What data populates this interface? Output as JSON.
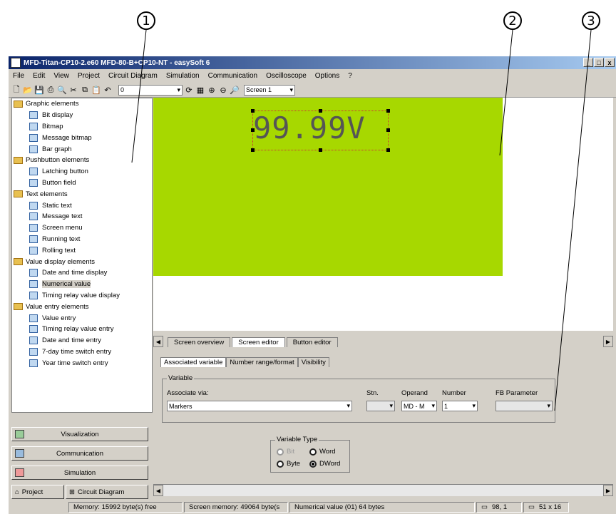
{
  "callouts": [
    "1",
    "2",
    "3"
  ],
  "window": {
    "title": "MFD-Titan-CP10-2.e60 MFD-80-B+CP10-NT - easySoft 6",
    "buttons": [
      "_",
      "□",
      "x"
    ]
  },
  "menu": [
    "File",
    "Edit",
    "View",
    "Project",
    "Circuit Diagram",
    "Simulation",
    "Communication",
    "Oscilloscope",
    "Options",
    "?"
  ],
  "toolbar": {
    "combo_value": "0",
    "screen_select": "Screen 1"
  },
  "sidebar": {
    "groups": [
      {
        "label": "Graphic elements",
        "items": [
          "Bit display",
          "Bitmap",
          "Message bitmap",
          "Bar graph"
        ]
      },
      {
        "label": "Pushbutton elements",
        "items": [
          "Latching button",
          "Button field"
        ]
      },
      {
        "label": "Text elements",
        "items": [
          "Static text",
          "Message text",
          "Screen menu",
          "Running text",
          "Rolling text"
        ]
      },
      {
        "label": "Value display elements",
        "items": [
          "Date and time display",
          "Numerical value",
          "Timing relay value display"
        ]
      },
      {
        "label": "Value entry elements",
        "items": [
          "Value entry",
          "Timing relay value entry",
          "Date and time entry",
          "7-day time switch entry",
          "Year time switch entry"
        ]
      }
    ],
    "selected": "Numerical value"
  },
  "nav_buttons": [
    "Visualization",
    "Communication",
    "Simulation"
  ],
  "bottom_nav": [
    "Project",
    "Circuit Diagram"
  ],
  "canvas": {
    "value_text": "99.99V",
    "lcd_color": "#a7d800"
  },
  "editor_tabs": [
    "Screen overview",
    "Screen editor",
    "Button editor"
  ],
  "prop_tabs": [
    "Associated variable",
    "Number range/format",
    "Visibility"
  ],
  "variable": {
    "group_label": "Variable",
    "associate_via_label": "Associate via:",
    "associate_via_value": "Markers",
    "stn_label": "Stn.",
    "operand_label": "Operand",
    "operand_value": "MD - M",
    "number_label": "Number",
    "number_value": "1",
    "fb_label": "FB Parameter"
  },
  "variable_type": {
    "label": "Variable Type",
    "options": [
      "Bit",
      "Word",
      "Byte",
      "DWord"
    ],
    "selected": "DWord"
  },
  "status": {
    "memory": "Memory: 15992 byte(s) free",
    "screen_memory": "Screen memory: 49064 byte(s",
    "numerical": "Numerical value (01)  64 bytes",
    "pos": "98, 1",
    "size": "51 x 16"
  }
}
